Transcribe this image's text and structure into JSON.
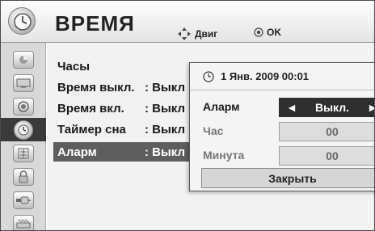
{
  "header": {
    "title": "ВРЕМЯ",
    "hint_move": "Двиг",
    "hint_ok": "OK"
  },
  "sidebar": {
    "items": [
      {
        "icon": "picture-icon"
      },
      {
        "icon": "screen-icon"
      },
      {
        "icon": "speaker-icon"
      },
      {
        "icon": "clock-icon",
        "active": true
      },
      {
        "icon": "option-icon"
      },
      {
        "icon": "lock-icon"
      },
      {
        "icon": "input-icon"
      },
      {
        "icon": "usb-icon"
      }
    ]
  },
  "menu": {
    "items": [
      {
        "label": "Часы",
        "value": ""
      },
      {
        "label": "Время выкл.",
        "value": ": Выкл"
      },
      {
        "label": "Время вкл.",
        "value": ": Выкл"
      },
      {
        "label": "Таймер сна",
        "value": ": Выкл"
      },
      {
        "label": "Аларм",
        "value": ": Выкл"
      }
    ],
    "selected_index": 4
  },
  "popup": {
    "datetime": "1 Янв. 2009 00:01",
    "rows": [
      {
        "label": "Аларм",
        "value": "Выкл.",
        "left_arrow": "◄",
        "right_arrow": "►"
      },
      {
        "label": "Час",
        "value": "00"
      },
      {
        "label": "Минута",
        "value": "00"
      }
    ],
    "close_label": "Закрыть"
  },
  "colors": {
    "selected_bg": "#5e5e5e",
    "active_field_bg": "#2f2f2f",
    "disabled_text": "#666666"
  }
}
